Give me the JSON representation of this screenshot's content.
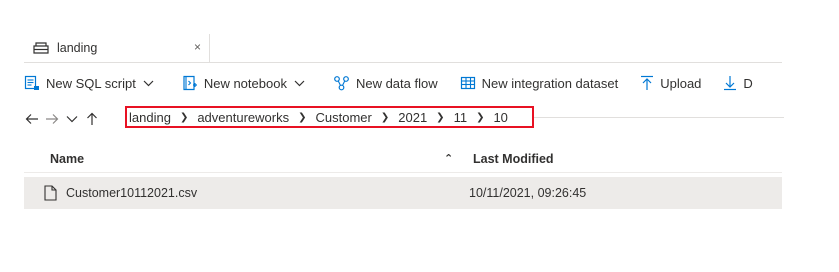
{
  "tab": {
    "label": "landing",
    "close_glyph": "×",
    "icon": "storage-container-icon"
  },
  "toolbar": {
    "items": [
      {
        "label": "New SQL script",
        "icon": "sql-script-icon",
        "has_dropdown": true
      },
      {
        "label": "New notebook",
        "icon": "notebook-icon",
        "has_dropdown": true
      },
      {
        "label": "New data flow",
        "icon": "data-flow-icon",
        "has_dropdown": false
      },
      {
        "label": "New integration dataset",
        "icon": "dataset-icon",
        "has_dropdown": false
      },
      {
        "label": "Upload",
        "icon": "upload-icon",
        "has_dropdown": false
      },
      {
        "label": "D",
        "icon": "download-icon",
        "has_dropdown": false
      }
    ]
  },
  "breadcrumb": {
    "items": [
      "landing",
      "adventureworks",
      "Customer",
      "2021",
      "11",
      "10"
    ],
    "highlight_color": "#e81123"
  },
  "table": {
    "columns": {
      "name": "Name",
      "modified": "Last Modified"
    },
    "rows": [
      {
        "name": "Customer10112021.csv",
        "modified": "10/11/2021, 09:26:45"
      }
    ]
  },
  "colors": {
    "accent": "#0078d4",
    "row_selected": "#edebe9"
  }
}
